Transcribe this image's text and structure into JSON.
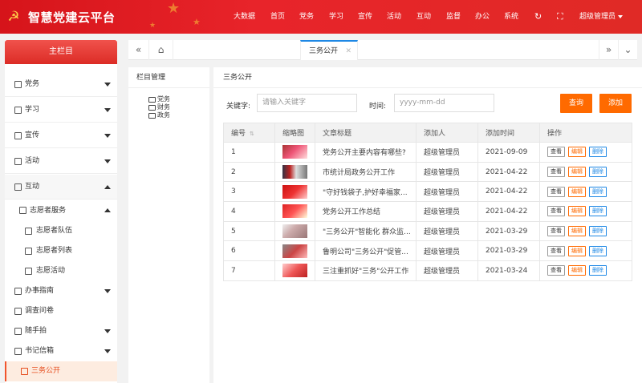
{
  "app": {
    "title": "智慧党建云平台"
  },
  "topnav": {
    "items": [
      "大数据",
      "首页",
      "党务",
      "学习",
      "宣传",
      "活动",
      "互动",
      "监督",
      "办公",
      "系统"
    ],
    "user": "超级管理员"
  },
  "sidebar": {
    "header": "主栏目",
    "items": [
      {
        "label": "党务"
      },
      {
        "label": "学习"
      },
      {
        "label": "宣传"
      },
      {
        "label": "活动"
      },
      {
        "label": "互动"
      }
    ],
    "sub": {
      "volunteer": "志愿者服务",
      "volunteer_children": [
        "志愿者队伍",
        "志愿者列表",
        "志愿活动"
      ],
      "others": [
        "办事指南",
        "调查问卷",
        "随手拍",
        "书记信箱",
        "三务公开"
      ]
    }
  },
  "tabs": {
    "active": "三务公开"
  },
  "column_panel": {
    "title": "栏目管理",
    "tree": [
      "党务",
      "财务",
      "政务"
    ]
  },
  "main": {
    "title": "三务公开",
    "search": {
      "keyword_label": "关键字:",
      "keyword_placeholder": "请输入关键字",
      "time_label": "时间:",
      "time_placeholder": "yyyy-mm-dd",
      "query_button": "查询",
      "add_button": "添加"
    },
    "table": {
      "headers": [
        "编号",
        "缩略图",
        "文章标题",
        "添加人",
        "添加时间",
        "操作"
      ],
      "actions": {
        "view": "查看",
        "edit": "编辑",
        "delete": "删除"
      },
      "rows": [
        {
          "id": "1",
          "title": "党务公开主要内容有哪些?",
          "author": "超级管理员",
          "date": "2021-09-09"
        },
        {
          "id": "2",
          "title": "市统计局政务公开工作",
          "author": "超级管理员",
          "date": "2021-04-22"
        },
        {
          "id": "3",
          "title": "\"守好钱袋子,护好幸福家...",
          "author": "超级管理员",
          "date": "2021-04-22"
        },
        {
          "id": "4",
          "title": "党务公开工作总结",
          "author": "超级管理员",
          "date": "2021-04-22"
        },
        {
          "id": "5",
          "title": "\"三务公开\"智能化 群众监...",
          "author": "超级管理员",
          "date": "2021-03-29"
        },
        {
          "id": "6",
          "title": "鲁明公司\"三务公开\"促管...",
          "author": "超级管理员",
          "date": "2021-03-29"
        },
        {
          "id": "7",
          "title": "三注重抓好\"三务\"公开工作",
          "author": "超级管理员",
          "date": "2021-03-24"
        }
      ]
    }
  },
  "colors": {
    "brand_red": "#e02a26",
    "accent_orange": "#ff6a00",
    "link_blue": "#1e88e5"
  }
}
